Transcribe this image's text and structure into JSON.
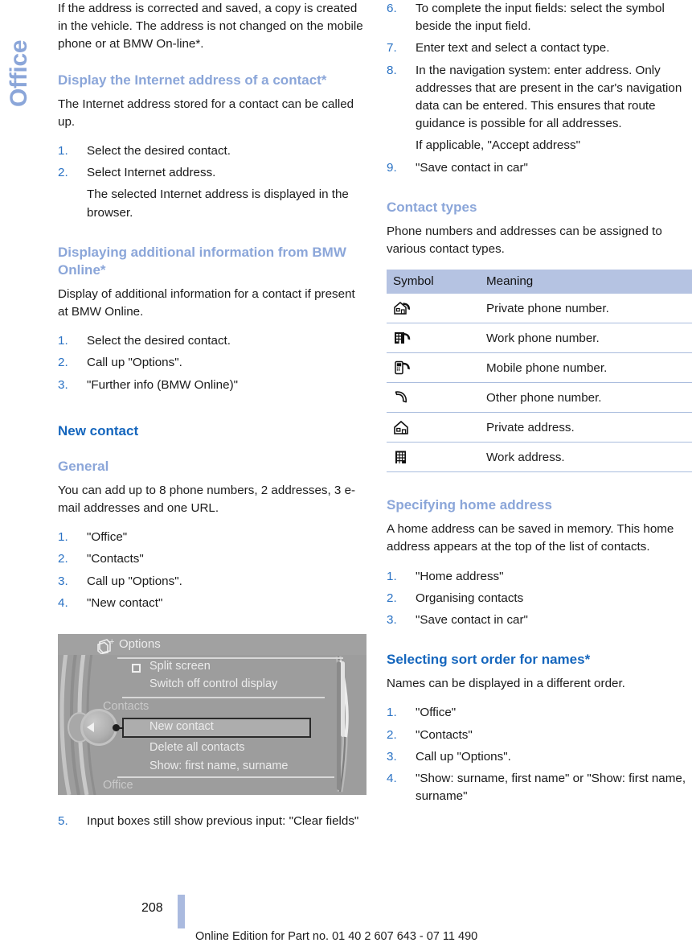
{
  "chapter_tab": {
    "label": "Office"
  },
  "left_column": {
    "intro_paragraph": "If the address is corrected and saved, a copy is created in the vehicle. The address is not changed on the mobile phone or at BMW On-line*.",
    "section_internet_address": {
      "heading": "Display the Internet address of a contact*",
      "paragraph": "The Internet address stored for a contact can be called up.",
      "steps": [
        {
          "num": "1.",
          "text": "Select the desired contact."
        },
        {
          "num": "2.",
          "text": "Select Internet address.",
          "sub": "The selected Internet address is displayed in the browser."
        }
      ]
    },
    "section_bmw_online": {
      "heading": "Displaying additional information from BMW Online*",
      "paragraph": "Display of additional information for a contact if present at BMW Online.",
      "steps": [
        {
          "num": "1.",
          "text": "Select the desired contact."
        },
        {
          "num": "2.",
          "text": "Call up \"Options\"."
        },
        {
          "num": "3.",
          "text": "\"Further info (BMW Online)\""
        }
      ]
    },
    "section_new_contact": {
      "heading": "New contact",
      "subheading": "General",
      "paragraph": "You can add up to 8 phone numbers, 2 addresses, 3 e-mail addresses and one URL.",
      "steps": [
        {
          "num": "1.",
          "text": "\"Office\""
        },
        {
          "num": "2.",
          "text": "\"Contacts\""
        },
        {
          "num": "3.",
          "text": "Call up \"Options\"."
        },
        {
          "num": "4.",
          "text": "\"New contact\""
        }
      ],
      "step_after_figure": {
        "num": "5.",
        "text": "Input boxes still show previous input: \"Clear fields\""
      }
    },
    "figure": {
      "title": "Options",
      "title_icon": "options-pages-plus-icon",
      "items": [
        {
          "label": "Split screen",
          "checkbox": true
        },
        {
          "label": "Switch off control display",
          "checkbox": false
        }
      ],
      "group_label": "Contacts",
      "contact_items": [
        {
          "label": "New contact",
          "highlighted": true
        },
        {
          "label": "Delete all contacts",
          "highlighted": false
        },
        {
          "label": "Show: first name, surname",
          "highlighted": false
        }
      ],
      "footer_label": "Office"
    }
  },
  "right_column": {
    "continued_steps": [
      {
        "num": "6.",
        "text": "To complete the input fields: select the symbol beside the input field."
      },
      {
        "num": "7.",
        "text": "Enter text and select a contact type."
      },
      {
        "num": "8.",
        "text": "In the navigation system: enter address. Only addresses that are present in the car's navigation data can be entered. This ensures that route guidance is possible for all addresses.",
        "sub": "If applicable, \"Accept address\""
      },
      {
        "num": "9.",
        "text": "\"Save contact in car\""
      }
    ],
    "section_contact_types": {
      "heading": "Contact types",
      "paragraph": "Phone numbers and addresses can be assigned to various contact types.",
      "table": {
        "headers": [
          "Symbol",
          "Meaning"
        ],
        "rows": [
          {
            "icon": "house-phone-icon",
            "meaning": "Private phone number."
          },
          {
            "icon": "building-phone-icon",
            "meaning": "Work phone number."
          },
          {
            "icon": "mobile-phone-icon",
            "meaning": "Mobile phone number."
          },
          {
            "icon": "handset-icon",
            "meaning": "Other phone number."
          },
          {
            "icon": "house-icon",
            "meaning": "Private address."
          },
          {
            "icon": "building-icon",
            "meaning": "Work address."
          }
        ]
      }
    },
    "section_home_address": {
      "heading": "Specifying home address",
      "paragraph": "A home address can be saved in memory. This home address appears at the top of the list of contacts.",
      "steps": [
        {
          "num": "1.",
          "text": "\"Home address\""
        },
        {
          "num": "2.",
          "text": "Organising contacts"
        },
        {
          "num": "3.",
          "text": "\"Save contact in car\""
        }
      ]
    },
    "section_sort_order": {
      "heading": "Selecting sort order for names*",
      "paragraph": "Names can be displayed in a different order.",
      "steps": [
        {
          "num": "1.",
          "text": "\"Office\""
        },
        {
          "num": "2.",
          "text": "\"Contacts\""
        },
        {
          "num": "3.",
          "text": "Call up \"Options\"."
        },
        {
          "num": "4.",
          "text": "\"Show: surname, first name\" or \"Show: first name, surname\""
        }
      ]
    }
  },
  "footer": {
    "page_number": "208",
    "note": "Online Edition for Part no. 01 40 2 607 643 - 07 11 490"
  },
  "colors": {
    "heading_major": "#1566bd",
    "heading_minor": "#8ba6d9",
    "step_number": "#2a72c4",
    "table_header_bg": "#b5c3e2",
    "table_rule": "#a9bcdd",
    "chapter_tab": "#8ba6d9",
    "page_rule": "#aabadf"
  }
}
